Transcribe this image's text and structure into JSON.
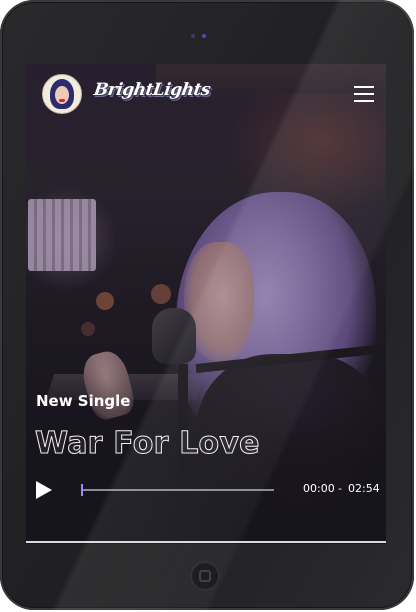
{
  "header": {
    "logo_text": "BrightLights"
  },
  "hero": {
    "kicker": "New Single",
    "title": "War For Love"
  },
  "player": {
    "current_time": "00:00",
    "separator": "-",
    "duration": "02:54",
    "progress": 0
  },
  "colors": {
    "accent": "#a585ff",
    "track": "#8d8a93",
    "text": "#ffffff"
  },
  "icons": {
    "menu": "hamburger-icon",
    "play": "play-icon"
  }
}
